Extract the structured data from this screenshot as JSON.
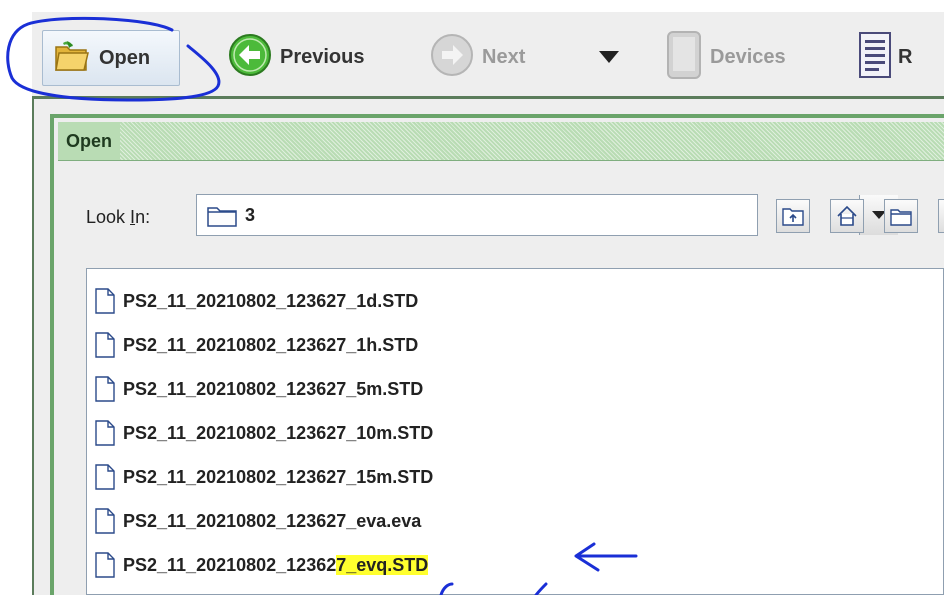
{
  "toolbar": {
    "open_label": "Open",
    "previous_label": "Previous",
    "next_label": "Next",
    "devices_label": "Devices",
    "report_label": "R"
  },
  "dialog": {
    "title": "Open",
    "look_in_label_pre": "Look ",
    "look_in_label_mnemonic": "I",
    "look_in_label_post": "n:",
    "look_in_value": "3"
  },
  "files": [
    {
      "name": "PS2_11_20210802_123627_1d.STD"
    },
    {
      "name": "PS2_11_20210802_123627_1h.STD"
    },
    {
      "name": "PS2_11_20210802_123627_5m.STD"
    },
    {
      "name": "PS2_11_20210802_123627_10m.STD"
    },
    {
      "name": "PS2_11_20210802_123627_15m.STD"
    },
    {
      "name": "PS2_11_20210802_123627_eva.eva"
    },
    {
      "name_before_highlight": "PS2_11_20210802_12362",
      "name_highlight": "7_evq.STD"
    }
  ],
  "colors": {
    "annotation_ink": "#1a2fd6",
    "highlight": "#ffff2e",
    "dialog_frame": "#6aa46a"
  },
  "icons": {
    "open": "folder-open-icon",
    "previous": "arrow-left-circle-icon",
    "next": "arrow-right-circle-icon",
    "menu": "triangle-down-icon",
    "devices": "tablet-device-icon",
    "report": "report-document-icon",
    "up_folder": "up-folder-icon",
    "home": "home-icon",
    "new_folder": "new-folder-icon",
    "file": "file-icon"
  }
}
